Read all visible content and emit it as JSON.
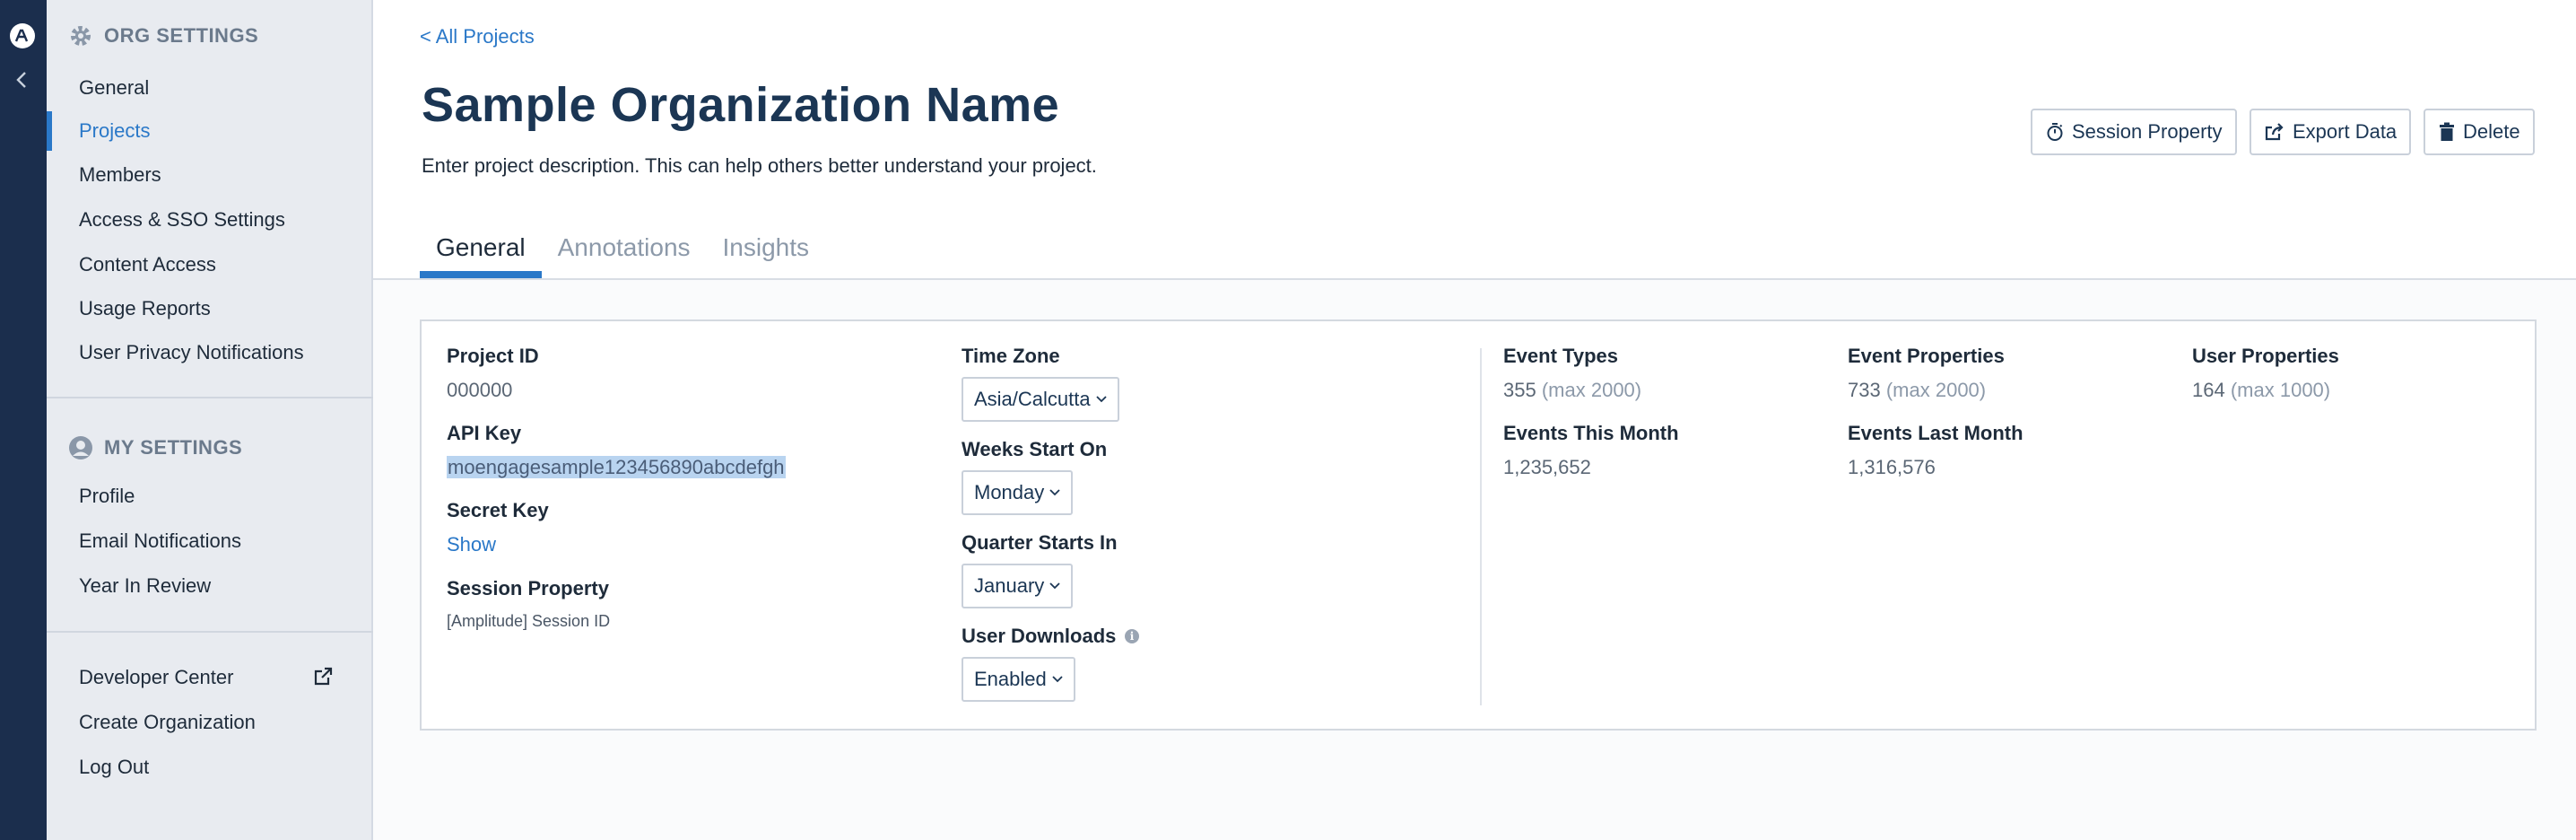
{
  "sidebar": {
    "org_header": "ORG SETTINGS",
    "org_items": [
      {
        "label": "General"
      },
      {
        "label": "Projects"
      },
      {
        "label": "Members"
      },
      {
        "label": "Access & SSO Settings"
      },
      {
        "label": "Content Access"
      },
      {
        "label": "Usage Reports"
      },
      {
        "label": "User Privacy Notifications"
      }
    ],
    "my_header": "MY SETTINGS",
    "my_items": [
      {
        "label": "Profile"
      },
      {
        "label": "Email Notifications"
      },
      {
        "label": "Year In Review"
      }
    ],
    "bottom_items": [
      {
        "label": "Developer Center"
      },
      {
        "label": "Create Organization"
      },
      {
        "label": "Log Out"
      }
    ]
  },
  "header": {
    "back_link": "< All Projects",
    "title": "Sample Organization Name",
    "description": "Enter project description. This can help others better understand your project.",
    "buttons": {
      "session_property": "Session Property",
      "export_data": "Export Data",
      "delete": "Delete"
    }
  },
  "tabs": [
    {
      "label": "General",
      "active": true
    },
    {
      "label": "Annotations",
      "active": false
    },
    {
      "label": "Insights",
      "active": false
    }
  ],
  "details": {
    "project_id_label": "Project ID",
    "project_id": "000000",
    "api_key_label": "API Key",
    "api_key": "moengagesample123456890abcdefgh",
    "secret_key_label": "Secret Key",
    "secret_key_action": "Show",
    "session_property_label": "Session Property",
    "session_property_value": "[Amplitude] Session ID",
    "time_zone_label": "Time Zone",
    "time_zone": "Asia/Calcutta",
    "week_start_label": "Weeks Start On",
    "week_start": "Monday",
    "quarter_start_label": "Quarter Starts In",
    "quarter_start": "January",
    "user_downloads_label": "User Downloads",
    "user_downloads": "Enabled"
  },
  "stats": {
    "event_types_label": "Event Types",
    "event_types": "355",
    "event_types_max": "(max 2000)",
    "event_props_label": "Event Properties",
    "event_props": "733",
    "event_props_max": "(max 2000)",
    "user_props_label": "User Properties",
    "user_props": "164",
    "user_props_max": "(max 1000)",
    "events_this_month_label": "Events This Month",
    "events_this_month": "1,235,652",
    "events_last_month_label": "Events Last Month",
    "events_last_month": "1,316,576"
  },
  "colors": {
    "accent": "#2a78c8",
    "rail": "#1b2e4d",
    "sidebar_bg": "#e8ebf0",
    "title": "#1b3654"
  }
}
